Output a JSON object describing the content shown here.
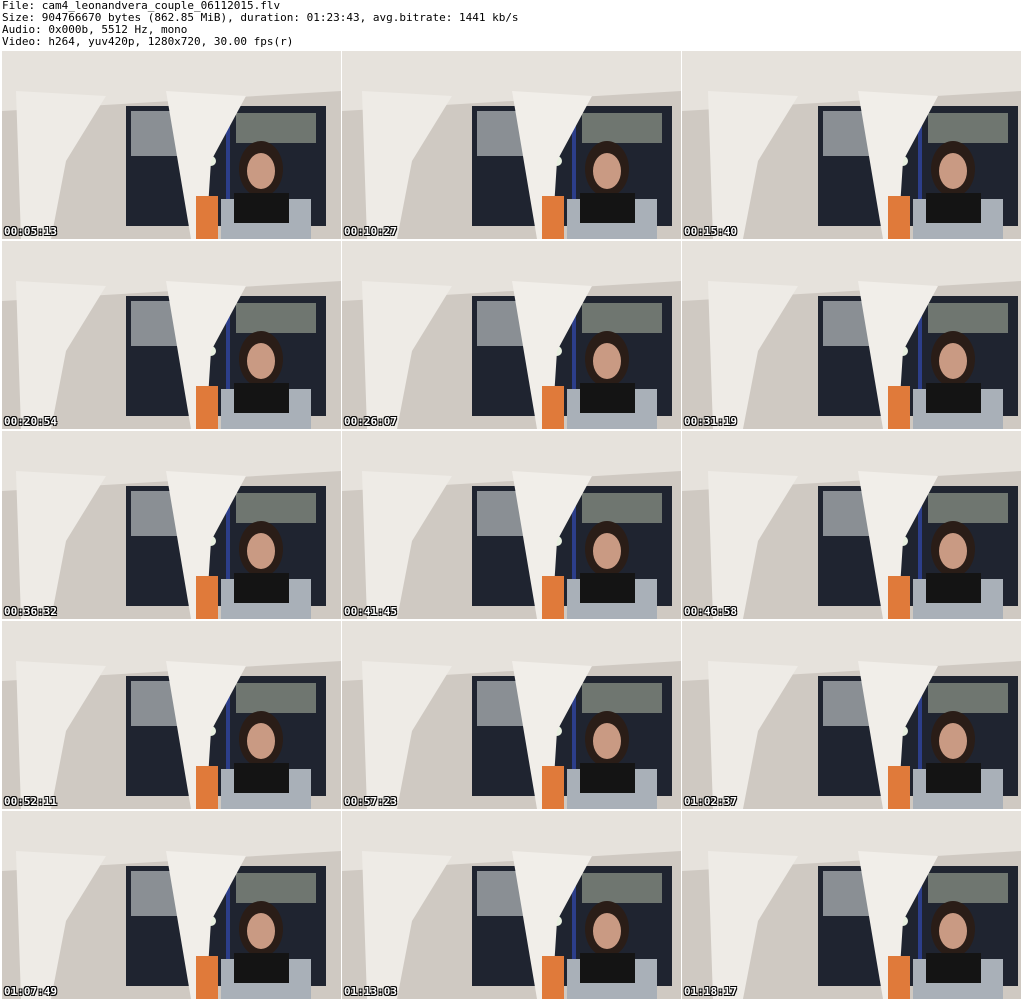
{
  "header": {
    "file_line": "File: cam4_leonandvera_couple_06112015.flv",
    "size_line": "Size: 904766670 bytes (862.85 MiB), duration: 01:23:43, avg.bitrate: 1441 kb/s",
    "audio_line": "Audio: 0x000b, 5512 Hz, mono",
    "video_line": "Video: h264, yuv420p, 1280x720, 30.00 fps(r)"
  },
  "thumbnails": [
    {
      "timestamp": "00:05:13"
    },
    {
      "timestamp": "00:10:27"
    },
    {
      "timestamp": "00:15:40"
    },
    {
      "timestamp": "00:20:54"
    },
    {
      "timestamp": "00:26:07"
    },
    {
      "timestamp": "00:31:19"
    },
    {
      "timestamp": "00:36:32"
    },
    {
      "timestamp": "00:41:45"
    },
    {
      "timestamp": "00:46:58"
    },
    {
      "timestamp": "00:52:11"
    },
    {
      "timestamp": "00:57:23"
    },
    {
      "timestamp": "01:02:37"
    },
    {
      "timestamp": "01:07:49"
    },
    {
      "timestamp": "01:13:03"
    },
    {
      "timestamp": "01:18:17"
    }
  ]
}
